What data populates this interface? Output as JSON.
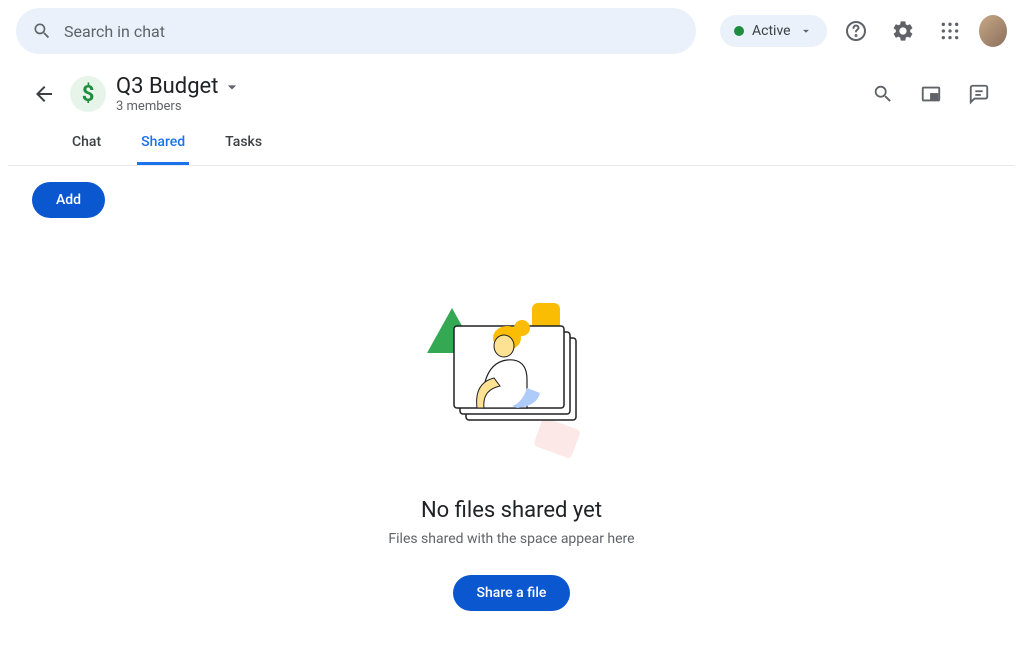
{
  "search": {
    "placeholder": "Search in chat"
  },
  "status": {
    "label": "Active"
  },
  "space": {
    "icon_color": "#1e8e3e",
    "title": "Q3 Budget",
    "members": "3 members"
  },
  "tabs": [
    {
      "label": "Chat",
      "active": false
    },
    {
      "label": "Shared",
      "active": true
    },
    {
      "label": "Tasks",
      "active": false
    }
  ],
  "actions": {
    "add": "Add",
    "share_file": "Share a file"
  },
  "empty_state": {
    "title": "No files shared yet",
    "subtitle": "Files shared with the space appear here"
  }
}
